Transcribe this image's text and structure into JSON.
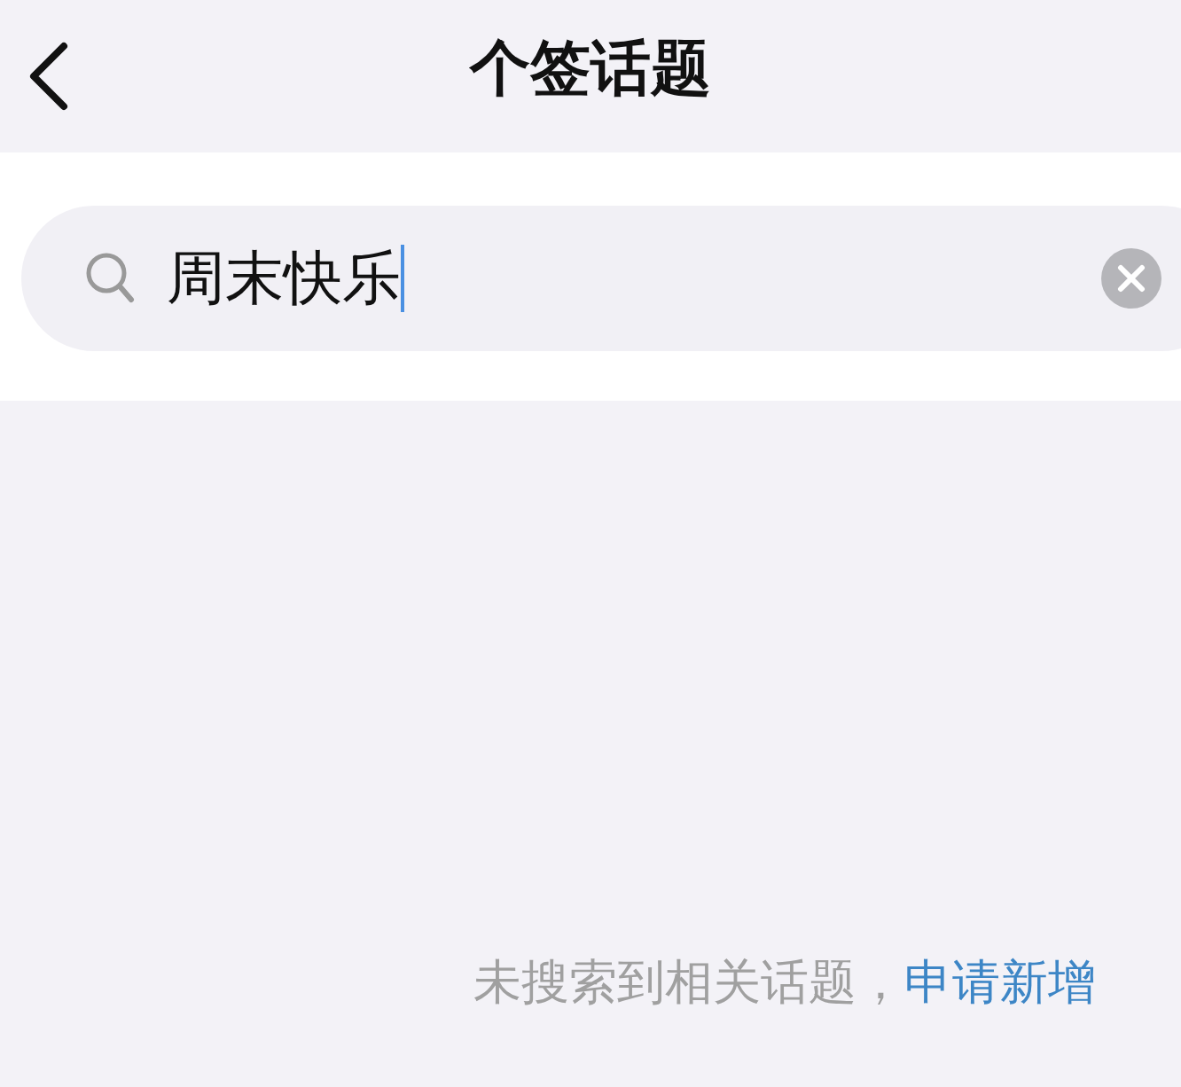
{
  "header": {
    "title": "个签话题"
  },
  "search": {
    "value": "周末快乐",
    "focused": true
  },
  "empty_state": {
    "message": "未搜索到相关话题，",
    "link": "申请新增"
  }
}
